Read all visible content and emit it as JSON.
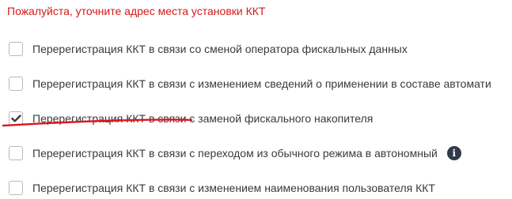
{
  "warning_text": "Пожалуйста, уточните адрес места установки ККТ",
  "options": [
    {
      "label": "Перерегистрация ККТ в связи со сменой оператора фискальных данных",
      "checked": false
    },
    {
      "label": "Перерегистрация ККТ в связи с изменением сведений о применении в составе автомати",
      "checked": false
    },
    {
      "label": "Перерегистрация ККТ в связи с заменой фискального накопителя",
      "checked": true
    },
    {
      "label": "Перерегистрация ККТ в связи с переходом из обычного режима в автономный",
      "checked": false,
      "info_icon": "info-icon",
      "info_glyph": "i"
    },
    {
      "label": "Перерегистрация ККТ в связи с изменением наименования пользователя ККТ",
      "checked": false
    }
  ],
  "colors": {
    "warning": "#d11a1a",
    "underline": "#e0141b",
    "text": "#3a3a3a",
    "checkbox_border": "#b9b9b9",
    "checkmark": "#2f3a46",
    "info_icon_bg": "#2f3a46"
  }
}
